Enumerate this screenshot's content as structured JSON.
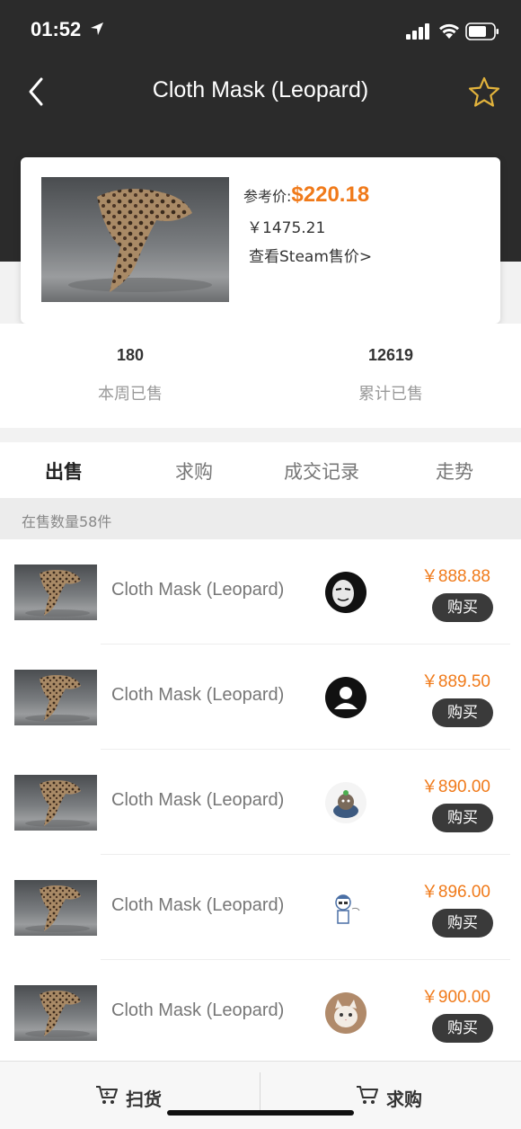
{
  "status_bar": {
    "time": "01:52"
  },
  "nav": {
    "title": "Cloth Mask (Leopard)"
  },
  "item": {
    "ref_label": "参考价:",
    "ref_price": "$220.18",
    "cny_price": "￥1475.21",
    "steam_link": "查看Steam售价>"
  },
  "stats": {
    "week": {
      "value": "180",
      "label": "本周已售"
    },
    "total": {
      "value": "12619",
      "label": "累计已售"
    }
  },
  "tabs": [
    "出售",
    "求购",
    "成交记录",
    "走势"
  ],
  "listing_count": "在售数量58件",
  "listings": [
    {
      "name": "Cloth Mask (Leopard)",
      "price": "￥888.88",
      "buy": "购买",
      "avatar": "mask-avatar"
    },
    {
      "name": "Cloth Mask (Leopard)",
      "price": "￥889.50",
      "buy": "购买",
      "avatar": "default-avatar"
    },
    {
      "name": "Cloth Mask (Leopard)",
      "price": "￥890.00",
      "buy": "购买",
      "avatar": "cartoon-avatar"
    },
    {
      "name": "Cloth Mask (Leopard)",
      "price": "￥896.00",
      "buy": "购买",
      "avatar": "sketch-avatar"
    },
    {
      "name": "Cloth Mask (Leopard)",
      "price": "￥900.00",
      "buy": "购买",
      "avatar": "cat-avatar"
    }
  ],
  "bottom": {
    "sweep": "扫货",
    "request": "求购"
  },
  "colors": {
    "accent": "#f07a1a",
    "header": "#2b2b2b",
    "star": "#e2b33c"
  }
}
